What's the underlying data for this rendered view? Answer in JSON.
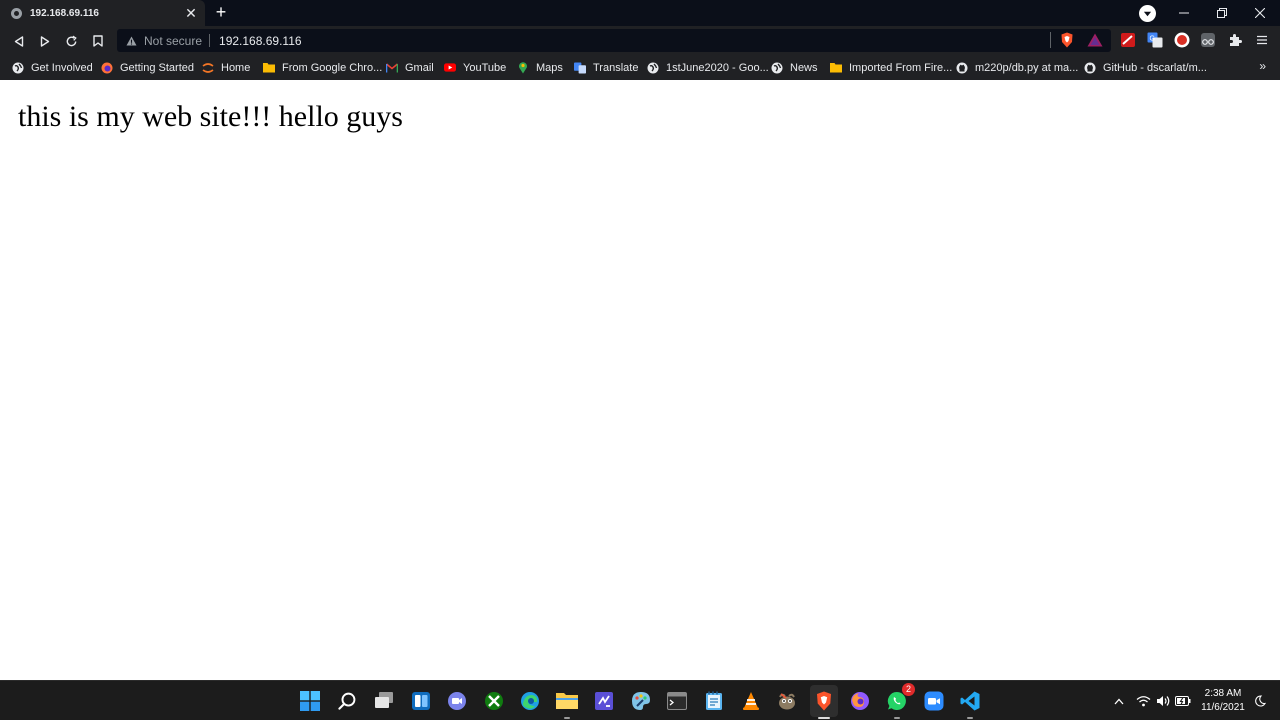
{
  "browser": {
    "tab": {
      "title": "192.168.69.116"
    },
    "omnibox": {
      "security_label": "Not secure",
      "url": "192.168.69.116"
    },
    "bookmarks": [
      {
        "label": "Get Involved",
        "icon": "globe-icon"
      },
      {
        "label": "Getting Started",
        "icon": "firefox-icon"
      },
      {
        "label": "Home",
        "icon": "jupyter-icon"
      },
      {
        "label": "From Google Chro...",
        "icon": "folder-icon"
      },
      {
        "label": "Gmail",
        "icon": "gmail-icon"
      },
      {
        "label": "YouTube",
        "icon": "youtube-icon"
      },
      {
        "label": "Maps",
        "icon": "maps-icon"
      },
      {
        "label": "Translate",
        "icon": "translate-icon"
      },
      {
        "label": "1stJune2020 - Goo...",
        "icon": "globe-icon"
      },
      {
        "label": "News",
        "icon": "globe-icon"
      },
      {
        "label": "Imported From Fire...",
        "icon": "folder-icon"
      },
      {
        "label": "m220p/db.py at ma...",
        "icon": "github-icon"
      },
      {
        "label": "GitHub - dscarlat/m...",
        "icon": "github-icon"
      }
    ],
    "bookmarks_more": "»"
  },
  "page": {
    "text": "this is my web site!!! hello guys"
  },
  "taskbar": {
    "apps": [
      {
        "name": "start",
        "icon": "windows-icon"
      },
      {
        "name": "search",
        "icon": "search-icon"
      },
      {
        "name": "task-view",
        "icon": "task-view-icon"
      },
      {
        "name": "widgets",
        "icon": "widgets-icon"
      },
      {
        "name": "teams-chat",
        "icon": "chat-icon"
      },
      {
        "name": "xbox",
        "icon": "xbox-icon"
      },
      {
        "name": "edge",
        "icon": "edge-icon"
      },
      {
        "name": "file-explorer",
        "icon": "folder-icon"
      },
      {
        "name": "visual-studio",
        "icon": "visual-studio-icon"
      },
      {
        "name": "paint",
        "icon": "paint-icon"
      },
      {
        "name": "terminal",
        "icon": "terminal-icon"
      },
      {
        "name": "notepad",
        "icon": "notepad-icon"
      },
      {
        "name": "vlc",
        "icon": "vlc-icon"
      },
      {
        "name": "gimp",
        "icon": "gimp-icon"
      },
      {
        "name": "brave",
        "icon": "brave-icon"
      },
      {
        "name": "firefox",
        "icon": "firefox-icon"
      },
      {
        "name": "whatsapp",
        "icon": "whatsapp-icon",
        "badge": "2"
      },
      {
        "name": "zoom",
        "icon": "zoom-icon"
      },
      {
        "name": "vscode",
        "icon": "vscode-icon"
      }
    ],
    "clock": {
      "time": "2:38 AM",
      "date": "11/6/2021"
    }
  },
  "colors": {
    "browser_chrome": "#202124",
    "tab_strip": "#0b0f19",
    "page_background": "#ffffff",
    "taskbar": "#1c1c1c",
    "brave_orange": "#fb542b",
    "windows_blue": "#2f9bf1"
  }
}
